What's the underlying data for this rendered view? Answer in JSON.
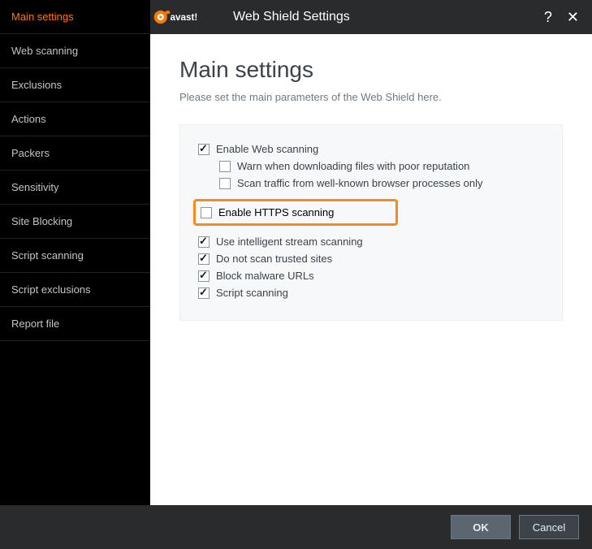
{
  "sidebar": {
    "items": [
      {
        "label": "Main settings",
        "active": true
      },
      {
        "label": "Web scanning"
      },
      {
        "label": "Exclusions"
      },
      {
        "label": "Actions"
      },
      {
        "label": "Packers"
      },
      {
        "label": "Sensitivity"
      },
      {
        "label": "Site Blocking"
      },
      {
        "label": "Script scanning"
      },
      {
        "label": "Script exclusions"
      },
      {
        "label": "Report file"
      }
    ]
  },
  "titlebar": {
    "app_label": "Web Shield Settings",
    "help_glyph": "?",
    "close_glyph": "✕"
  },
  "page": {
    "title": "Main settings",
    "subtitle": "Please set the main parameters of the Web Shield here."
  },
  "options": {
    "enable_web_scanning": {
      "label": "Enable Web scanning",
      "checked": true
    },
    "warn_poor_reputation": {
      "label": "Warn when downloading files with poor reputation",
      "checked": false
    },
    "scan_known_browser": {
      "label": "Scan traffic from well-known browser processes only",
      "checked": false
    },
    "enable_https": {
      "label": "Enable HTTPS scanning",
      "checked": false
    },
    "intelligent_stream": {
      "label": "Use intelligent stream scanning",
      "checked": true
    },
    "no_scan_trusted": {
      "label": "Do not scan trusted sites",
      "checked": true
    },
    "block_malware_urls": {
      "label": "Block malware URLs",
      "checked": true
    },
    "script_scanning": {
      "label": "Script scanning",
      "checked": true
    }
  },
  "footer": {
    "ok": "OK",
    "cancel": "Cancel"
  }
}
